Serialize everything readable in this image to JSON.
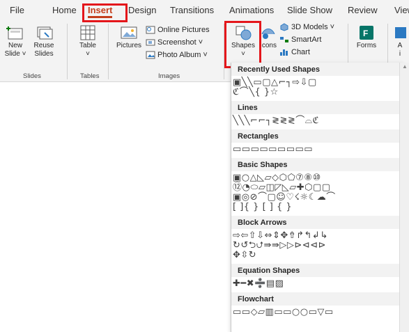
{
  "tabs": [
    "File",
    "Home",
    "Insert",
    "Design",
    "Transitions",
    "Animations",
    "Slide Show",
    "Review",
    "View"
  ],
  "active_tab": "Insert",
  "ribbon": {
    "slides_group": {
      "label": "Slides",
      "new_slide": [
        "New",
        "Slide ˅"
      ],
      "reuse_slides": [
        "Reuse",
        "Slides"
      ]
    },
    "tables_group": {
      "label": "Tables",
      "table": [
        "Table",
        "˅"
      ]
    },
    "images_group": {
      "label": "Images",
      "pictures": "Pictures",
      "online_pictures": "Online Pictures",
      "screenshot": "Screenshot ˅",
      "photo_album": "Photo Album ˅"
    },
    "illustrations_group": {
      "shapes": [
        "Shapes",
        "˅"
      ],
      "icons": "Icons",
      "models_3d": "3D Models ˅",
      "smartart": "SmartArt",
      "chart": "Chart"
    },
    "forms": "Forms",
    "partial": [
      "A",
      "i"
    ]
  },
  "shapes_panel": {
    "sections": [
      {
        "title": "Recently Used Shapes",
        "rows": [
          "▣╲╲▭▢△⌐┐⇨⇩▢",
          "ℭ⌒╲{ }☆"
        ]
      },
      {
        "title": "Lines",
        "rows": [
          "╲╲╲⌐⌐┐≷≷≷⌒⌓ℭ"
        ]
      },
      {
        "title": "Rectangles",
        "rows": [
          "▭▭▭▭▭▭▭▭▭"
        ]
      },
      {
        "title": "Basic Shapes",
        "rows": [
          "▣○△◺▱◇⬡⬠⑦⑧⑩",
          "⑫◔⬭▱◫◸◺▱✚⬡▢▢",
          "▣◎⊘⌒▢☺♡☇☼☾☁⌒",
          "[ ]{ } [ ] { }"
        ]
      },
      {
        "title": "Block Arrows",
        "rows": [
          "⇨⇦⇧⇩⇔⇕✥⇮↱↰↲↳",
          "↻↺⮌⮍⇛⇛▷▷⊳⊲⊲⊳",
          "✥⇳↻"
        ]
      },
      {
        "title": "Equation Shapes",
        "rows": [
          "✚━✖➗▤▨"
        ]
      },
      {
        "title": "Flowchart",
        "rows": [
          "▭▭◇▱▥▭▭○○▭▽▭"
        ]
      }
    ]
  },
  "colors": {
    "accent": "#c43e1c",
    "highlight": "#e4161b",
    "ribbon_bg": "#f3f3f3"
  }
}
